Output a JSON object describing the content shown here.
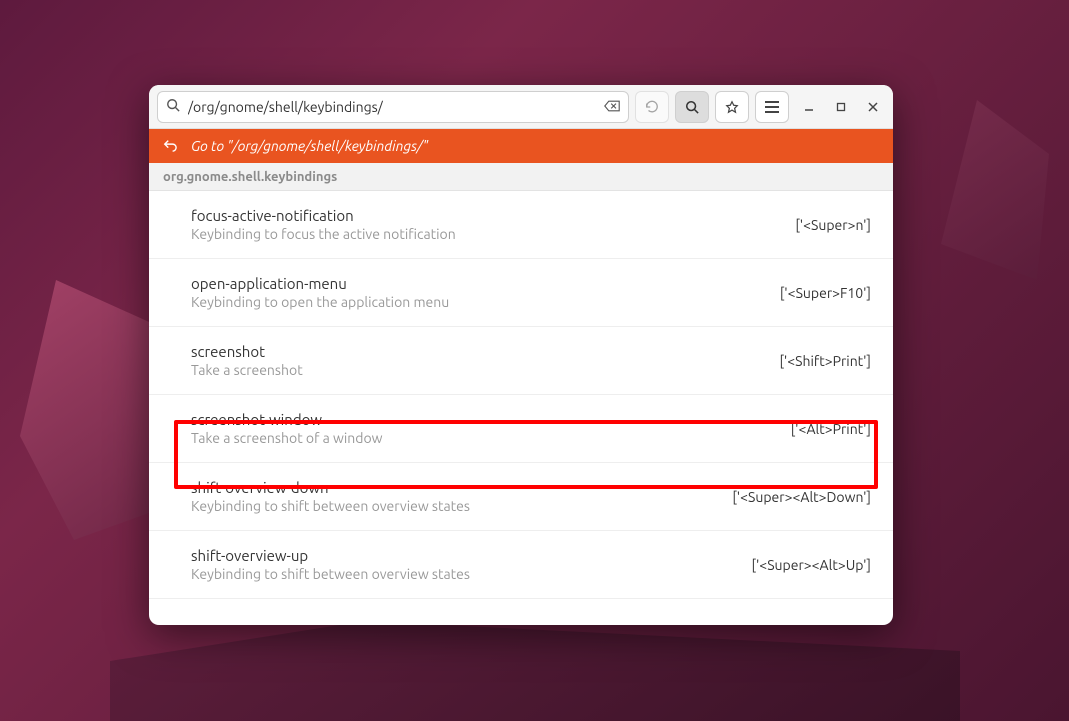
{
  "header": {
    "search_value": "/org/gnome/shell/keybindings/"
  },
  "goto": {
    "label": "Go to \"/org/gnome/shell/keybindings/\""
  },
  "schema": {
    "name": "org.gnome.shell.keybindings"
  },
  "results": [
    {
      "key": "focus-active-notification",
      "desc": "Keybinding to focus the active notification",
      "value": "['<Super>n']"
    },
    {
      "key": "open-application-menu",
      "desc": "Keybinding to open the application menu",
      "value": "['<Super>F10']"
    },
    {
      "key": "screenshot",
      "desc": "Take a screenshot",
      "value": "['<Shift>Print']"
    },
    {
      "key": "screenshot-window",
      "desc": "Take a screenshot of a window",
      "value": "['<Alt>Print']"
    },
    {
      "key": "shift-overview-down",
      "desc": "Keybinding to shift between overview states",
      "value": "['<Super><Alt>Down']"
    },
    {
      "key": "shift-overview-up",
      "desc": "Keybinding to shift between overview states",
      "value": "['<Super><Alt>Up']"
    }
  ]
}
